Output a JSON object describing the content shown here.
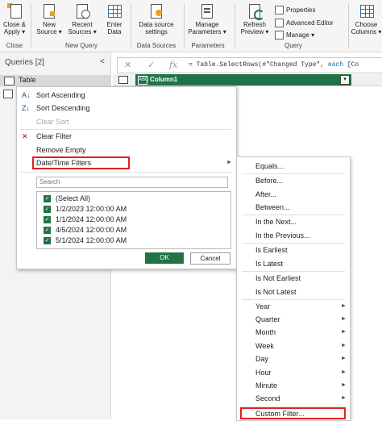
{
  "ribbon": {
    "buttons": [
      {
        "label1": "Close &",
        "label2": "Apply ▾"
      },
      {
        "label1": "New",
        "label2": "Source ▾"
      },
      {
        "label1": "Recent",
        "label2": "Sources ▾"
      },
      {
        "label1": "Enter",
        "label2": "Data"
      },
      {
        "label1": "Data source",
        "label2": "settings"
      },
      {
        "label1": "Manage",
        "label2": "Parameters ▾"
      },
      {
        "label1": "Refresh",
        "label2": "Preview ▾"
      },
      {
        "label1": "Choose",
        "label2": "Columns ▾"
      }
    ],
    "small": {
      "properties": "Properties",
      "advanced_editor": "Advanced Editor",
      "manage": "Manage ▾"
    },
    "groups": {
      "close": "Close",
      "new_query": "New Query",
      "data_sources": "Data Sources",
      "parameters": "Parameters",
      "query": "Query"
    }
  },
  "queries_pane": {
    "title": "Queries [2]",
    "collapse": "<",
    "item": "Table"
  },
  "formula_bar": {
    "cancel": "✕",
    "commit": "✓",
    "fx": "fx",
    "prefix": "= Table.SelectRows(#\"Changed Type\", ",
    "keyword": "each",
    "suffix": " [Co"
  },
  "column": {
    "type_icon": "ABC",
    "name": "Column1",
    "filter_icon": "▾"
  },
  "filter_menu": {
    "sort_ascending": "Sort Ascending",
    "sort_descending": "Sort Descending",
    "clear_sort": "Clear Sort",
    "clear_filter": "Clear Filter",
    "remove_empty": "Remove Empty",
    "date_time_filters": "Date/Time Filters",
    "search_placeholder": "Search",
    "list": [
      "(Select All)",
      "1/2/2023 12:00:00 AM",
      "1/1/2024 12:00:00 AM",
      "4/5/2024 12:00:00 AM",
      "5/1/2024 12:00:00 AM"
    ],
    "ok": "OK",
    "cancel": "Cancel"
  },
  "datetime_submenu": {
    "equals": "Equals...",
    "before": "Before...",
    "after": "After...",
    "between": "Between...",
    "in_the_next": "In the Next...",
    "in_the_previous": "In the Previous...",
    "is_earliest": "Is Earliest",
    "is_latest": "Is Latest",
    "is_not_earliest": "Is Not Earliest",
    "is_not_latest": "Is Not Latest",
    "year": "Year",
    "quarter": "Quarter",
    "month": "Month",
    "week": "Week",
    "day": "Day",
    "hour": "Hour",
    "minute": "Minute",
    "second": "Second",
    "custom_filter": "Custom Filter..."
  },
  "colors": {
    "accent": "#217346",
    "highlight": "#e02020",
    "keyword": "#0070c0"
  }
}
